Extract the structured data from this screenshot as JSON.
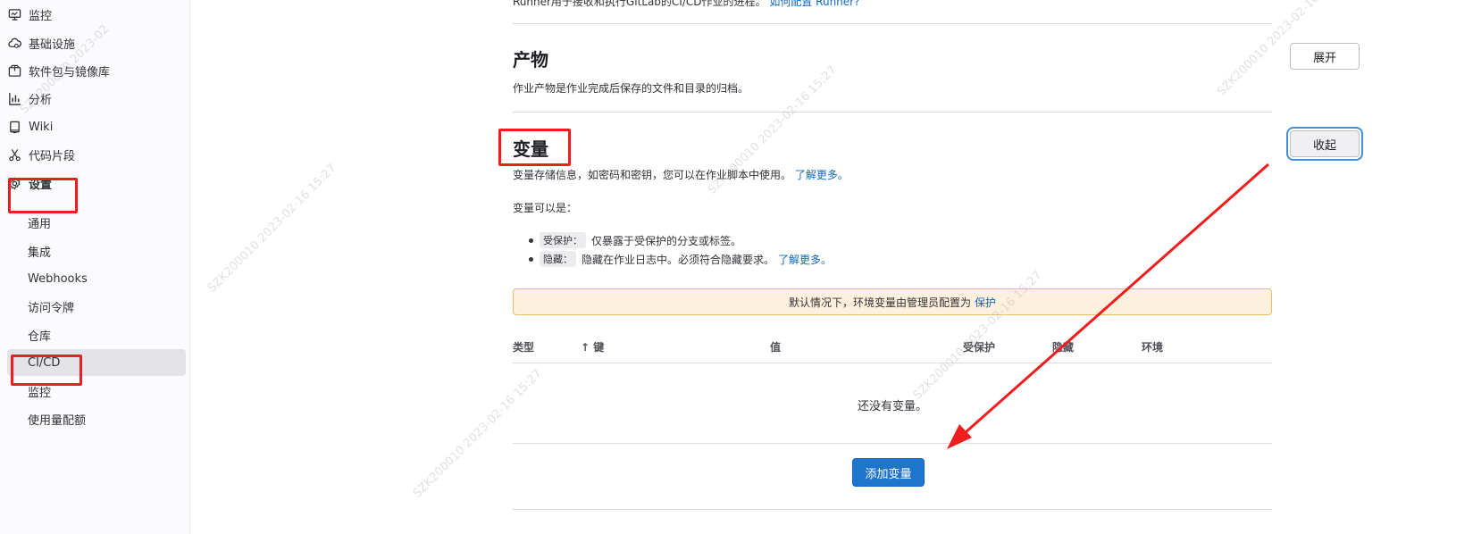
{
  "sidebar": {
    "items": [
      {
        "label": "监控",
        "icon": "monitor-icon"
      },
      {
        "label": "基础设施",
        "icon": "cloud-gear-icon"
      },
      {
        "label": "软件包与镜像库",
        "icon": "package-icon"
      },
      {
        "label": "分析",
        "icon": "chart-icon"
      },
      {
        "label": "Wiki",
        "icon": "book-icon"
      },
      {
        "label": "代码片段",
        "icon": "scissors-icon"
      },
      {
        "label": "设置",
        "icon": "gear-icon"
      }
    ],
    "subitems": [
      "通用",
      "集成",
      "Webhooks",
      "访问令牌",
      "仓库",
      "CI/CD",
      "监控",
      "使用量配额"
    ]
  },
  "runner_section": {
    "desc": "Runner用于接收和执行GitLab的CI/CD作业的进程。",
    "link": "如何配置 Runner?"
  },
  "artifacts": {
    "title": "产物",
    "desc": "作业产物是作业完成后保存的文件和目录的归档。",
    "button": "展开"
  },
  "variables": {
    "title": "变量",
    "desc": "变量存储信息，如密码和密钥，您可以在作业脚本中使用。",
    "learn_more": "了解更多。",
    "intro": "变量可以是：",
    "button": "收起",
    "list": [
      {
        "code": "受保护：",
        "text": "仅暴露于受保护的分支或标签。",
        "link": ""
      },
      {
        "code": "隐藏：",
        "text": "隐藏在作业日志中。必须符合隐藏要求。",
        "link": "了解更多。"
      }
    ],
    "alert_text": "默认情况下，环境变量由管理员配置为",
    "alert_link": "保护",
    "table": {
      "headers": [
        "类型",
        "↑ 键",
        "值",
        "受保护",
        "隐藏",
        "环境"
      ],
      "empty": "还没有变量。"
    },
    "add_button": "添加变量"
  },
  "watermark": "SZK200010 2023-02-16 15:27",
  "annotation_color": "#ef1d1d"
}
